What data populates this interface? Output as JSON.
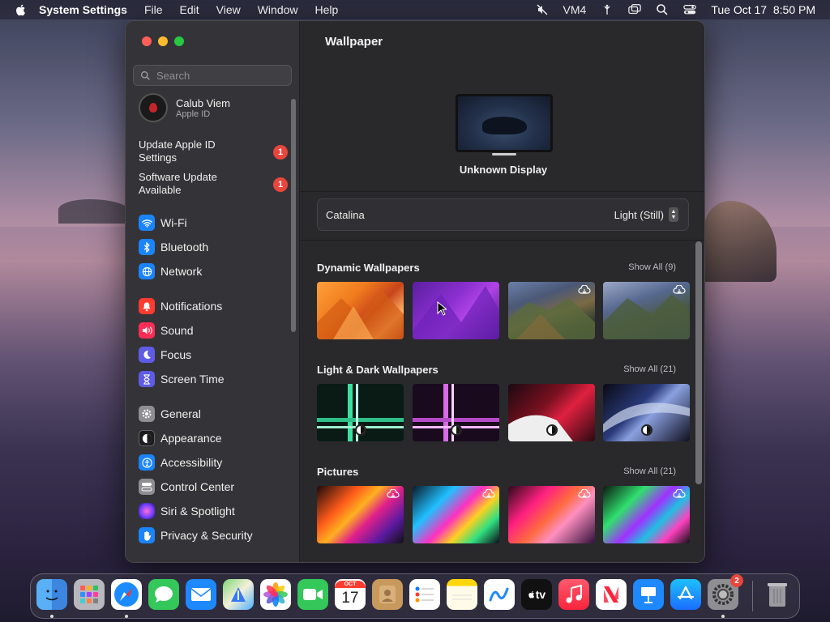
{
  "menubar": {
    "app_name": "System Settings",
    "items": [
      "File",
      "Edit",
      "View",
      "Window",
      "Help"
    ],
    "vm_label": "VM4",
    "datetime": "Tue Oct 17  8:50 PM"
  },
  "sidebar": {
    "search_placeholder": "Search",
    "account": {
      "name": "Calub Viem",
      "subtitle": "Apple ID"
    },
    "alerts": [
      {
        "label": "Update Apple ID Settings",
        "badge": "1"
      },
      {
        "label": "Software Update Available",
        "badge": "1"
      }
    ],
    "items": [
      {
        "label": "Wi-Fi",
        "icon": "wifi-icon",
        "color": "#1a84ff"
      },
      {
        "label": "Bluetooth",
        "icon": "bluetooth-icon",
        "color": "#1a84ff"
      },
      {
        "label": "Network",
        "icon": "globe-icon",
        "color": "#1a84ff"
      },
      {
        "label": "Notifications",
        "icon": "bell-icon",
        "color": "#ff3b30"
      },
      {
        "label": "Sound",
        "icon": "speaker-icon",
        "color": "#ff2d55"
      },
      {
        "label": "Focus",
        "icon": "moon-icon",
        "color": "#5e5ce6"
      },
      {
        "label": "Screen Time",
        "icon": "hourglass-icon",
        "color": "#5e5ce6"
      },
      {
        "label": "General",
        "icon": "gear-icon",
        "color": "#8e8e93"
      },
      {
        "label": "Appearance",
        "icon": "appearance-icon",
        "color": "#1c1c1e"
      },
      {
        "label": "Accessibility",
        "icon": "accessibility-icon",
        "color": "#1a84ff"
      },
      {
        "label": "Control Center",
        "icon": "control-center-icon",
        "color": "#8e8e93"
      },
      {
        "label": "Siri & Spotlight",
        "icon": "siri-icon",
        "color": "#bf5af2"
      },
      {
        "label": "Privacy & Security",
        "icon": "hand-icon",
        "color": "#1a84ff"
      }
    ]
  },
  "main": {
    "title": "Wallpaper",
    "display_name": "Unknown Display",
    "wallpaper_name": "Catalina",
    "wallpaper_mode": "Light (Still)",
    "sections": [
      {
        "title": "Dynamic Wallpapers",
        "show_all": "Show All (9)"
      },
      {
        "title": "Light & Dark Wallpapers",
        "show_all": "Show All (21)"
      },
      {
        "title": "Pictures",
        "show_all": "Show All (21)"
      }
    ]
  },
  "dock": {
    "apps": [
      "Finder",
      "Launchpad",
      "Safari",
      "Messages",
      "Mail",
      "Maps",
      "Photos",
      "FaceTime",
      "Calendar",
      "Contacts",
      "Reminders",
      "Notes",
      "Freeform",
      "TV",
      "Music",
      "News",
      "Keynote",
      "App Store",
      "System Settings",
      "Trash"
    ],
    "calendar_month": "OCT",
    "calendar_day": "17",
    "tv_label": "tv",
    "settings_badge": "2"
  },
  "colors": {
    "accent": "#1a84ff",
    "badge": "#e8453c",
    "window_bg": "#29292c",
    "sidebar_bg": "#343438"
  }
}
